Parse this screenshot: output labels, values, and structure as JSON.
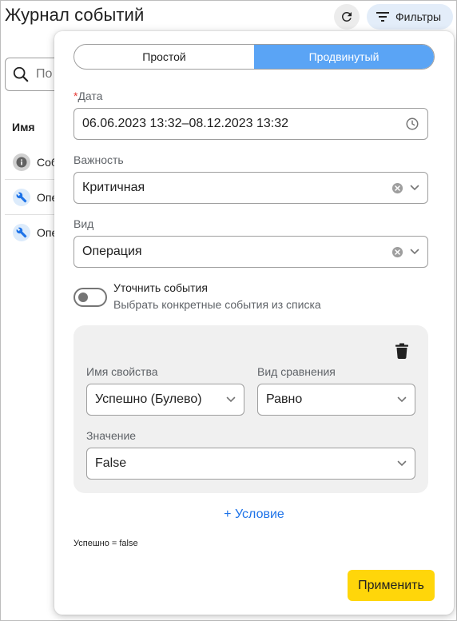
{
  "page": {
    "title": "Журнал событий"
  },
  "toolbar": {
    "filters_label": "Фильтры"
  },
  "search": {
    "placeholder_partial": "По"
  },
  "table": {
    "header": "Имя",
    "rows": [
      {
        "icon": "info-icon",
        "text": "Соб"
      },
      {
        "icon": "wrench-icon",
        "text": "Опе"
      },
      {
        "icon": "wrench-icon",
        "text": "Опе"
      }
    ]
  },
  "filter_panel": {
    "modes": [
      "Простой",
      "Продвинутый"
    ],
    "active_mode": "Продвинутый",
    "date": {
      "required_mark": "*",
      "label": "Дата",
      "value": "06.06.2023 13:32–08.12.2023 13:32"
    },
    "severity": {
      "label": "Важность",
      "value": "Критичная"
    },
    "kind": {
      "label": "Вид",
      "value": "Операция"
    },
    "refine": {
      "title": "Уточнить события",
      "subtitle": "Выбрать конкретные события из списка",
      "enabled": false
    },
    "condition": {
      "property_label": "Имя свойства",
      "property_value": "Успешно (Булево)",
      "comparison_label": "Вид сравнения",
      "comparison_value": "Равно",
      "value_label": "Значение",
      "value_value": "False"
    },
    "add_condition": "+ Условие",
    "summary": "Успешно = false",
    "apply": "Применить"
  },
  "colors": {
    "accent": "#5aa4f5",
    "apply": "#ffd60a",
    "link": "#1e73e8",
    "required": "#e53935"
  }
}
